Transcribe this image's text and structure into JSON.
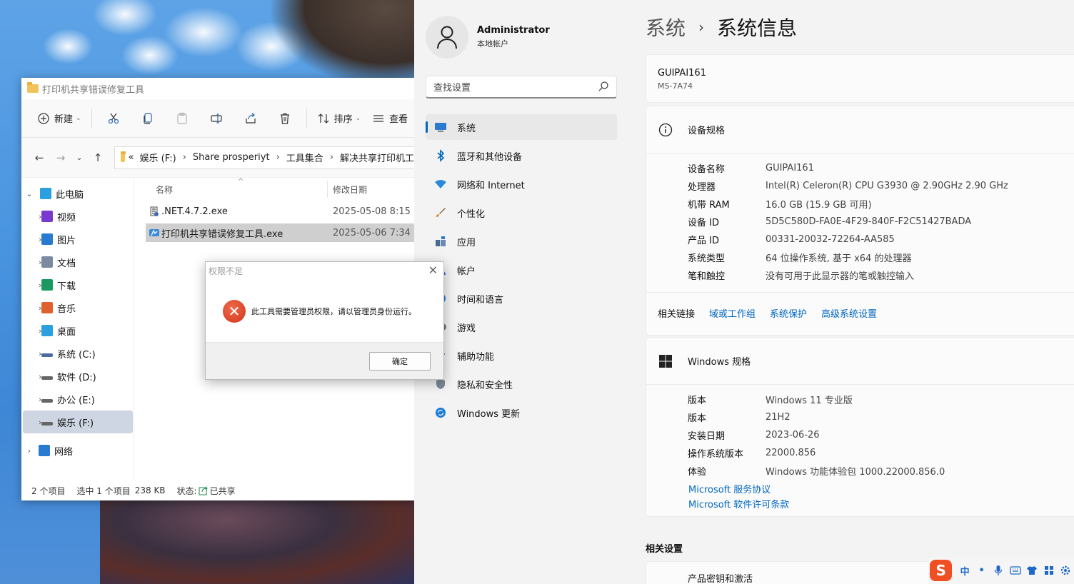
{
  "explorer": {
    "title": "打印机共享错误修复工具",
    "toolbar": {
      "new_label": "新建",
      "sort_label": "排序",
      "view_label": "查看"
    },
    "breadcrumb": [
      "«",
      "娱乐 (F:)",
      "Share prosperiyt",
      "工具集合",
      "解决共享打印机工"
    ],
    "tree": [
      {
        "label": "此电脑",
        "icon": "computer-icon",
        "color": "#2aa0e0"
      },
      {
        "label": "视频",
        "icon": "video-icon",
        "color": "#7a3ad0"
      },
      {
        "label": "图片",
        "icon": "picture-icon",
        "color": "#2a7ad0"
      },
      {
        "label": "文档",
        "icon": "document-icon",
        "color": "#7a8aa0"
      },
      {
        "label": "下载",
        "icon": "download-icon",
        "color": "#1a9a60"
      },
      {
        "label": "音乐",
        "icon": "music-icon",
        "color": "#e06030"
      },
      {
        "label": "桌面",
        "icon": "desktop-icon",
        "color": "#2aa0e0"
      },
      {
        "label": "系统 (C:)",
        "icon": "drive-icon",
        "color": "#4a6aa0"
      },
      {
        "label": "软件 (D:)",
        "icon": "drive-icon",
        "color": "#666666"
      },
      {
        "label": "办公 (E:)",
        "icon": "drive-icon",
        "color": "#666666"
      },
      {
        "label": "娱乐 (F:)",
        "icon": "drive-icon",
        "color": "#666666"
      },
      {
        "label": "网络",
        "icon": "network-icon",
        "color": "#2a7ad0"
      }
    ],
    "columns": {
      "name": "名称",
      "date": "修改日期"
    },
    "files": [
      {
        "name": ".NET.4.7.2.exe",
        "date": "2025-05-08 8:15"
      },
      {
        "name": "打印机共享错误修复工具.exe",
        "date": "2025-05-06 7:34"
      }
    ],
    "status": {
      "count": "2 个项目",
      "selected": "选中 1 个项目",
      "size": "238 KB",
      "state_label": "状态:",
      "state_value": "已共享"
    }
  },
  "dialog": {
    "title": "权限不足",
    "message": "此工具需要管理员权限，请以管理员身份运行。",
    "ok": "确定"
  },
  "settings": {
    "user": {
      "name": "Administrator",
      "type": "本地帐户"
    },
    "search_placeholder": "查找设置",
    "nav": [
      {
        "label": "系统",
        "icon": "system-icon"
      },
      {
        "label": "蓝牙和其他设备",
        "icon": "bluetooth-icon"
      },
      {
        "label": "网络和 Internet",
        "icon": "wifi-icon"
      },
      {
        "label": "个性化",
        "icon": "brush-icon"
      },
      {
        "label": "应用",
        "icon": "apps-icon"
      },
      {
        "label": "帐户",
        "icon": "account-icon"
      },
      {
        "label": "时间和语言",
        "icon": "clock-icon"
      },
      {
        "label": "游戏",
        "icon": "gamepad-icon"
      },
      {
        "label": "辅助功能",
        "icon": "accessibility-icon"
      },
      {
        "label": "隐私和安全性",
        "icon": "shield-icon"
      },
      {
        "label": "Windows 更新",
        "icon": "update-icon"
      }
    ],
    "breadcrumb": {
      "parent": "系统",
      "current": "系统信息"
    },
    "device": {
      "name": "GUIPAI161",
      "model": "MS-7A74"
    },
    "device_spec": {
      "title": "设备规格",
      "rows": [
        {
          "k": "设备名称",
          "v": "GUIPAI161"
        },
        {
          "k": "处理器",
          "v": "Intel(R) Celeron(R) CPU G3930 @ 2.90GHz   2.90 GHz"
        },
        {
          "k": "机带 RAM",
          "v": "16.0 GB (15.9 GB 可用)"
        },
        {
          "k": "设备 ID",
          "v": "5D5C580D-FA0E-4F29-840F-F2C51427BADA"
        },
        {
          "k": "产品 ID",
          "v": "00331-20032-72264-AA585"
        },
        {
          "k": "系统类型",
          "v": "64 位操作系统, 基于 x64 的处理器"
        },
        {
          "k": "笔和触控",
          "v": "没有可用于此显示器的笔或触控输入"
        }
      ]
    },
    "related": {
      "title": "相关链接",
      "links": [
        "域或工作组",
        "系统保护",
        "高级系统设置"
      ]
    },
    "win_spec": {
      "title": "Windows 规格",
      "rows": [
        {
          "k": "版本",
          "v": "Windows 11 专业版"
        },
        {
          "k": "版本",
          "v": "21H2"
        },
        {
          "k": "安装日期",
          "v": "2023-06-26"
        },
        {
          "k": "操作系统版本",
          "v": "22000.856"
        },
        {
          "k": "体验",
          "v": "Windows 功能体验包 1000.22000.856.0"
        }
      ],
      "links": [
        "Microsoft 服务协议",
        "Microsoft 软件许可条款"
      ]
    },
    "related_settings": {
      "title": "相关设置",
      "first": "产品密钥和激活"
    }
  },
  "tray": {
    "ime_logo": "S",
    "ime_lang": "中"
  }
}
